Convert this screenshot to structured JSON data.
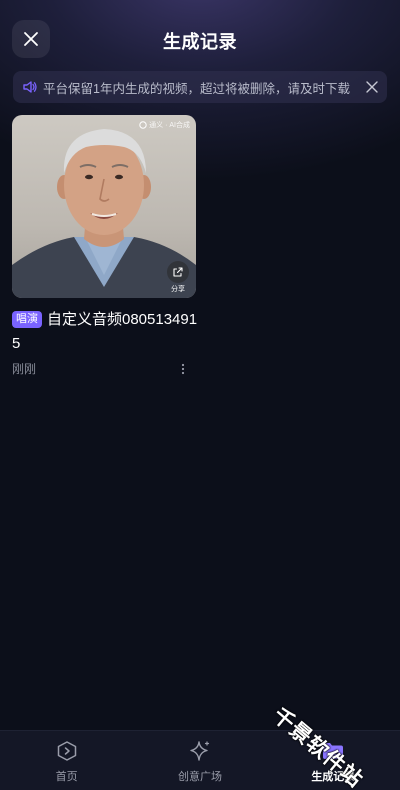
{
  "header": {
    "title": "生成记录"
  },
  "notice": {
    "text": "平台保留1年内生成的视频，超过将被删除，请及时下载"
  },
  "records": [
    {
      "tag": "唱演",
      "title": "自定义音频0805134915",
      "time": "刚刚",
      "watermark": "通义 · AI合成",
      "share_label": "分享"
    }
  ],
  "tabbar": {
    "items": [
      {
        "label": "首页",
        "icon": "home-play-icon",
        "active": false
      },
      {
        "label": "创意广场",
        "icon": "sparkle-icon",
        "active": false
      },
      {
        "label": "生成记录",
        "icon": "records-folder-icon",
        "active": true
      }
    ]
  },
  "site_watermark": "千景软件站",
  "colors": {
    "background": "#0c0f1a",
    "accent": "#7a63ff",
    "tab_bar": "#141726"
  }
}
